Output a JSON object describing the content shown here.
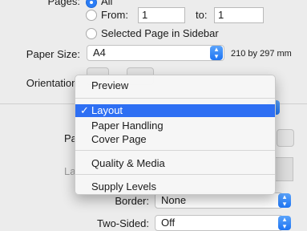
{
  "pages": {
    "label": "Pages:",
    "all_label": "All",
    "from_label": "From:",
    "from_value": "1",
    "to_label": "to:",
    "to_value": "1",
    "selected_label": "Selected Page in Sidebar"
  },
  "paper": {
    "label": "Paper Size:",
    "value": "A4",
    "dimensions": "210 by 297 mm"
  },
  "orientation": {
    "label": "Orientation:"
  },
  "behind": {
    "pa": "Pa",
    "la": "La",
    "border_label": "Border:",
    "border_value": "None",
    "twosided_label": "Two-Sided:",
    "twosided_value": "Off"
  },
  "menu": {
    "check": "✓",
    "items": [
      "Preview",
      "Layout",
      "Paper Handling",
      "Cover Page",
      "Quality & Media",
      "Supply Levels"
    ],
    "selected": "Layout"
  }
}
